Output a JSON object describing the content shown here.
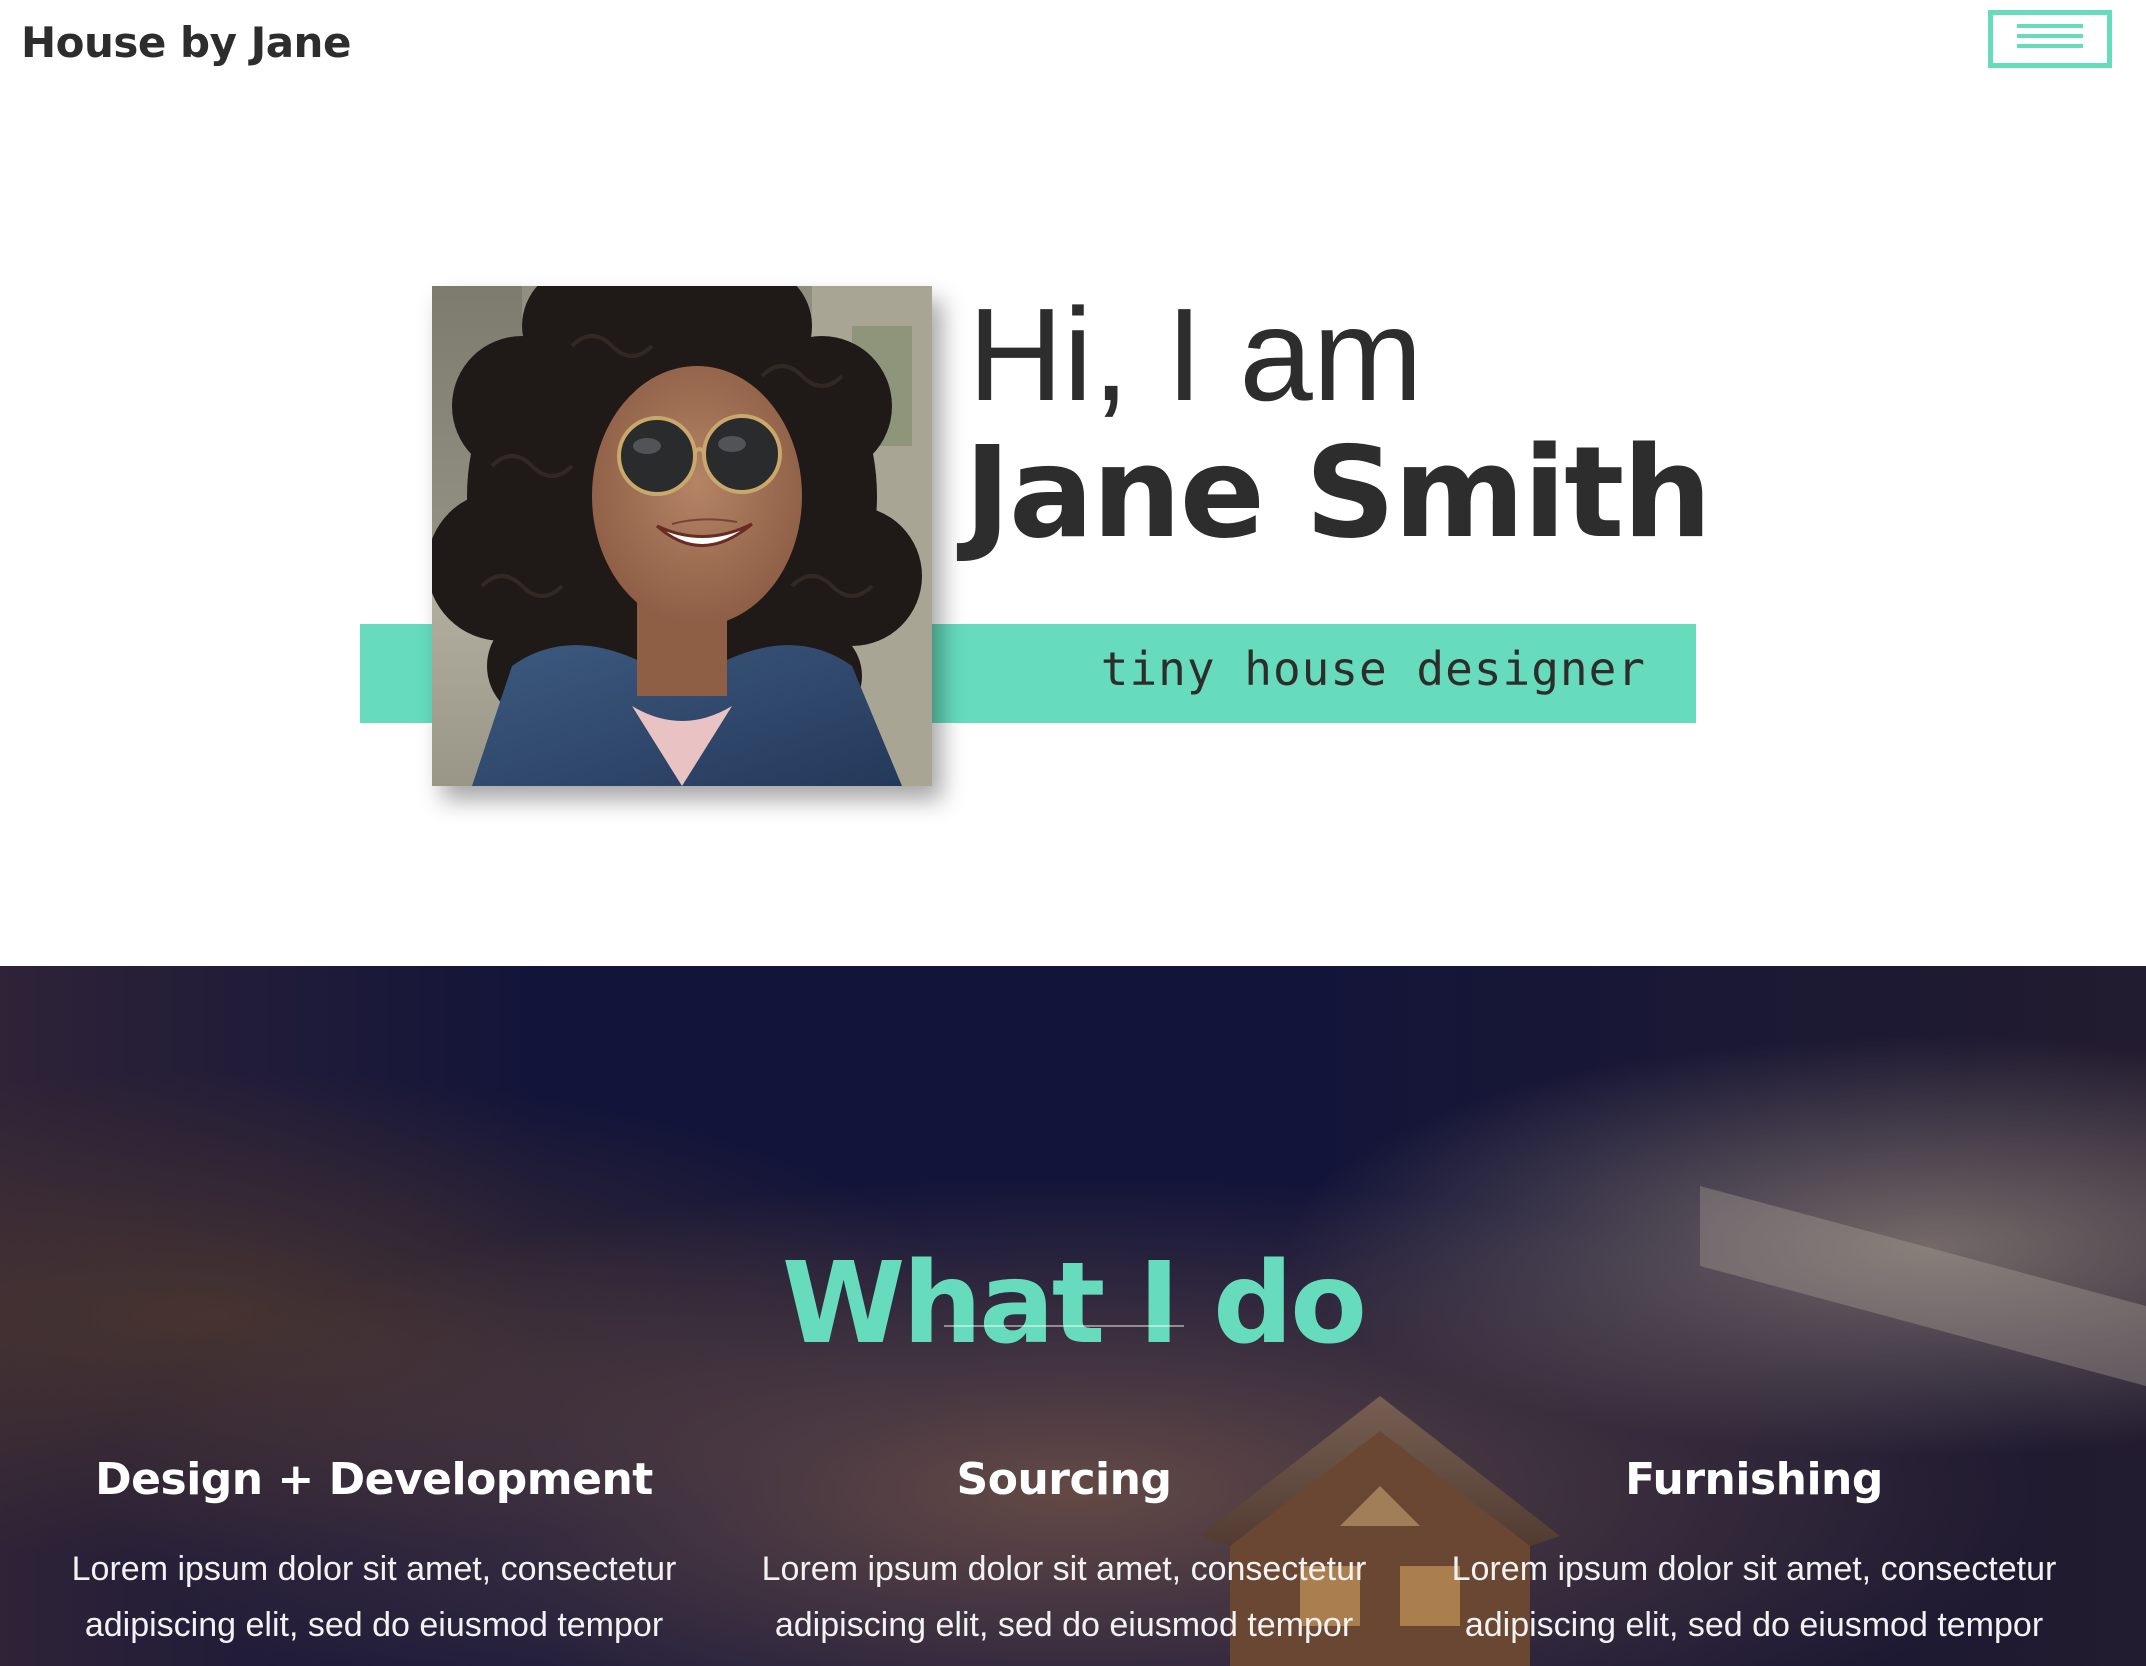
{
  "header": {
    "brand": "House by Jane",
    "menu_icon": "hamburger-menu-icon",
    "accent_color": "#66dcbd"
  },
  "hero": {
    "greeting": "Hi, I am",
    "name": "Jane Smith",
    "tagline": "tiny house designer",
    "portrait": "portrait-photo"
  },
  "services": {
    "title": "What I do",
    "items": [
      {
        "title": "Design + Development",
        "text": "Lorem ipsum dolor sit amet, consectetur adipiscing elit, sed do eiusmod tempor"
      },
      {
        "title": "Sourcing",
        "text": "Lorem ipsum dolor sit amet, consectetur adipiscing elit, sed do eiusmod tempor"
      },
      {
        "title": "Furnishing",
        "text": "Lorem ipsum dolor sit amet, consectetur adipiscing elit, sed do eiusmod tempor"
      }
    ]
  }
}
